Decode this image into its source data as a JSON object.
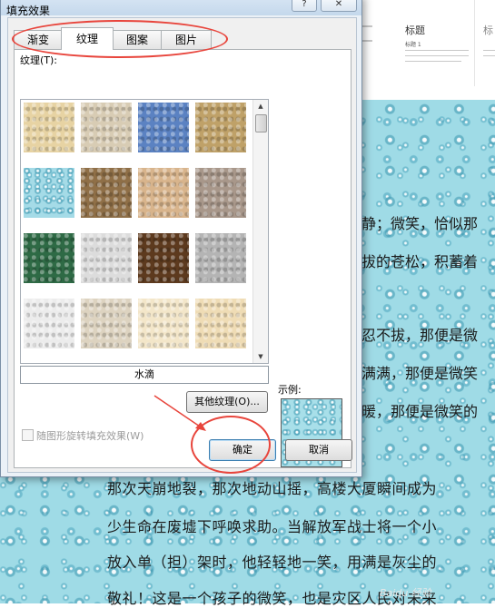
{
  "dialog": {
    "title": "填充效果",
    "help_button": "?",
    "close_button": "✕",
    "tabs": [
      {
        "label": "渐变",
        "active": false
      },
      {
        "label": "纹理",
        "active": true
      },
      {
        "label": "图案",
        "active": false
      },
      {
        "label": "图片",
        "active": false
      }
    ],
    "texture_label": "纹理(T):",
    "textures": [
      {
        "name": "papyrus",
        "color": "#e7d3a3"
      },
      {
        "name": "canvas",
        "color": "#d8ccb4"
      },
      {
        "name": "denim",
        "color": "#5b82c2"
      },
      {
        "name": "woven mat",
        "color": "#bfa168"
      },
      {
        "name": "water droplets",
        "color": "#a5dbe7"
      },
      {
        "name": "paper bag",
        "color": "#8f6f47"
      },
      {
        "name": "fish fossil",
        "color": "#d8b48c"
      },
      {
        "name": "sand",
        "color": "#a8978a"
      },
      {
        "name": "green marble",
        "color": "#2e6a45"
      },
      {
        "name": "white marble",
        "color": "#dcdcdc"
      },
      {
        "name": "brown marble",
        "color": "#5d3a1e"
      },
      {
        "name": "granite",
        "color": "#b4b4b4"
      },
      {
        "name": "newsprint",
        "color": "#ececec"
      },
      {
        "name": "recycled paper",
        "color": "#ddd3c0"
      },
      {
        "name": "parchment",
        "color": "#f3e6c9"
      },
      {
        "name": "stationery",
        "color": "#efdcb5"
      }
    ],
    "selected_texture_name": "水滴",
    "other_texture_button": "其他纹理(O)...",
    "sample_label": "示例:",
    "rotate_checkbox_label": "随图形旋转填充效果(W)",
    "ok_button": "确定",
    "cancel_button": "取消"
  },
  "document": {
    "thumbnails": [
      {
        "title": "标题",
        "subtitle": "标题 1"
      },
      {
        "title": "标",
        "subtitle": ""
      }
    ],
    "right_lines": [
      "静；微笑，恰似那",
      "拔的苍松，积蓄着",
      "忍不拔，那便是微",
      "满满，那便是微笑",
      "暖，那便是微笑的"
    ],
    "bottom_lines": [
      "那次天崩地裂，那次地动山摇，高楼大厦瞬间成为",
      "少生命在废墟下呼唤求助。当解放军战士将一个小",
      "放入单（担）架时，他轻轻地一笑，用满是灰尘的",
      "敬礼！这是一个孩子的微笑，也是灾区人民对未来"
    ],
    "watermark": "Baidu 经验"
  },
  "colors": {
    "annotation_red": "#e8453c",
    "dialog_bg": "#ebf1f7"
  }
}
